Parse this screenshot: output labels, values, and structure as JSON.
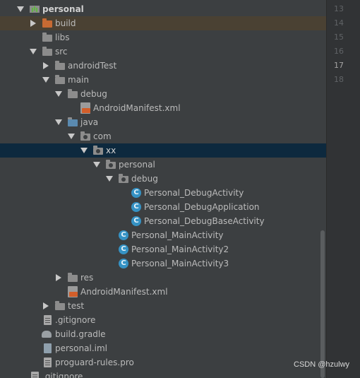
{
  "tree": {
    "rows": [
      {
        "label": "personal",
        "icon": "module-icon",
        "arrow": "down",
        "bold": true
      },
      {
        "label": "build",
        "icon": "folder-orange-icon",
        "arrow": "right"
      },
      {
        "label": "libs",
        "icon": "folder-icon",
        "arrow": "none"
      },
      {
        "label": "src",
        "icon": "folder-icon",
        "arrow": "down"
      },
      {
        "label": "androidTest",
        "icon": "folder-icon",
        "arrow": "right"
      },
      {
        "label": "main",
        "icon": "folder-icon",
        "arrow": "down"
      },
      {
        "label": "debug",
        "icon": "folder-icon",
        "arrow": "down"
      },
      {
        "label": "AndroidManifest.xml",
        "icon": "manifest-icon",
        "arrow": "none"
      },
      {
        "label": "java",
        "icon": "folder-icon",
        "arrow": "down"
      },
      {
        "label": "com",
        "icon": "package-icon",
        "arrow": "down"
      },
      {
        "label": "xx",
        "icon": "package-icon",
        "arrow": "down",
        "selected": true
      },
      {
        "label": "personal",
        "icon": "package-icon",
        "arrow": "down"
      },
      {
        "label": "debug",
        "icon": "package-icon",
        "arrow": "down"
      },
      {
        "label": "Personal_DebugActivity",
        "icon": "class-icon",
        "arrow": "none"
      },
      {
        "label": "Personal_DebugApplication",
        "icon": "class-icon",
        "arrow": "none"
      },
      {
        "label": "Personal_DebugBaseActivity",
        "icon": "class-icon",
        "arrow": "none"
      },
      {
        "label": "Personal_MainActivity",
        "icon": "class-icon",
        "arrow": "none"
      },
      {
        "label": "Personal_MainActivity2",
        "icon": "class-icon",
        "arrow": "none"
      },
      {
        "label": "Personal_MainActivity3",
        "icon": "class-icon",
        "arrow": "none"
      },
      {
        "label": "res",
        "icon": "folder-res-icon",
        "arrow": "right"
      },
      {
        "label": "AndroidManifest.xml",
        "icon": "manifest-icon",
        "arrow": "none"
      },
      {
        "label": "test",
        "icon": "folder-icon",
        "arrow": "right"
      },
      {
        "label": ".gitignore",
        "icon": "gitignore-icon",
        "arrow": "none"
      },
      {
        "label": "build.gradle",
        "icon": "gradle-icon",
        "arrow": "none"
      },
      {
        "label": "personal.iml",
        "icon": "iml-icon",
        "arrow": "none"
      },
      {
        "label": "proguard-rules.pro",
        "icon": "file-icon",
        "arrow": "none"
      },
      {
        "label": ".gitignore",
        "icon": "gitignore-icon",
        "arrow": "none"
      }
    ],
    "class_icon_letter": "C"
  },
  "gutter": {
    "line_numbers": [
      "13",
      "14",
      "15",
      "16",
      "17",
      "18"
    ],
    "active_line": "17"
  },
  "watermark": "CSDN @hzulwy",
  "colors": {
    "background": "#3c3f41",
    "selected_row": "#0d293e",
    "highlighted_row": "#4a4133",
    "class_icon": "#3592c4",
    "folder_orange": "#c76a33"
  }
}
